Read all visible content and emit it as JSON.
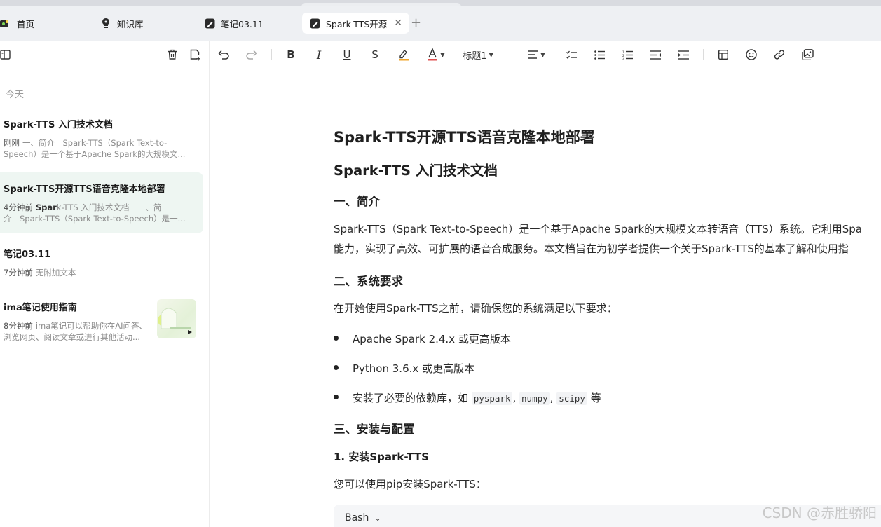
{
  "tabs": [
    {
      "label": "首页",
      "icon": "home-icon"
    },
    {
      "label": "知识库",
      "icon": "lightbulb-icon"
    },
    {
      "label": "笔记03.11",
      "icon": "note-icon"
    },
    {
      "label": "Spark-TTS开源",
      "icon": "note-icon",
      "active": true
    }
  ],
  "sidebar": {
    "section_label": "今天",
    "notes": [
      {
        "title": "Spark-TTS 入门技术文档",
        "time": "刚刚",
        "line1": "一、简介　Spark-TTS（Spark Text-to-",
        "line2": "Speech）是一个基于Apache Spark的大规模文..."
      },
      {
        "title": "Spark-TTS开源TTS语音克隆本地部署",
        "time": "4分钟前",
        "hl": "Spar",
        "line1_rest": "k-TTS 入门技术文档　一、简",
        "line2": "介　Spark-TTS（Spark Text-to-Speech）是一..."
      },
      {
        "title": "笔记03.11",
        "time": "7分钟前",
        "line1": "无附加文本"
      },
      {
        "title": "ima笔记使用指南",
        "time": "8分钟前",
        "line1": "ima笔记可以帮助你在AI问答、",
        "line2": "浏览网页、阅读文章或进行其他活动..."
      }
    ]
  },
  "toolbar": {
    "heading_select": "标题1"
  },
  "doc": {
    "title": "Spark-TTS开源TTS语音克隆本地部署",
    "h2": "Spark-TTS 入门技术文档",
    "s1": "一、简介",
    "p1a": "Spark-TTS（Spark Text-to-Speech）是一个基于Apache Spark的大规模文本转语音（TTS）系统。它利用Spa",
    "p1b": "能力，实现了高效、可扩展的语音合成服务。本文档旨在为初学者提供一个关于Spark-TTS的基本了解和使用指",
    "s2": "二、系统要求",
    "p2": "在开始使用Spark-TTS之前，请确保您的系统满足以下要求：",
    "li1": "Apache Spark 2.4.x 或更高版本",
    "li2": "Python 3.6.x 或更高版本",
    "li3_pre": "安装了必要的依赖库，如",
    "li3_c1": "pyspark",
    "li3_c2": "numpy",
    "li3_c3": "scipy",
    "li3_post": "等",
    "s3": "三、安装与配置",
    "s3_1": "1. 安装Spark-TTS",
    "p3": "您可以使用pip安装Spark-TTS：",
    "code_lang": "Bash"
  },
  "watermark": "CSDN @赤胜骄阳"
}
